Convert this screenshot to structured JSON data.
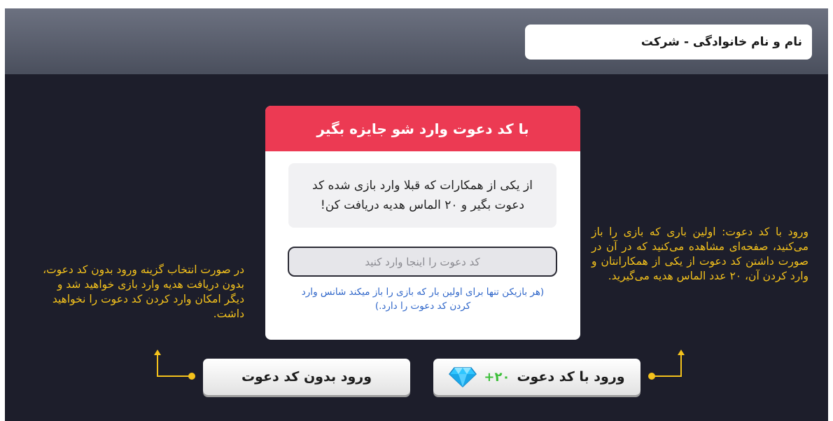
{
  "header": {
    "name_label": "نام و نام خانوادگی  -  شرکت"
  },
  "dialog": {
    "title": "با کد دعوت وارد شو جایزه بگیر",
    "message": "از یکی از همکارات که قبلا وارد بازی شده کد دعوت بگیر و ۲۰ الماس هدیه دریافت کن!",
    "input_placeholder": "کد دعوت را اینجا وارد کنید",
    "input_value": "",
    "note": "(هر بازیکن تنها برای اولین بار که بازی را باز میکند شانس وارد کردن کد دعوت را دارد.)"
  },
  "left_note": "در صورت انتخاب گزینه ورود بدون کد دعوت، بدون دریافت هدیه وارد بازی خواهید شد و دیگر امکان وارد کردن کد دعوت را نخواهید داشت.",
  "right_note": "ورود با کد دعوت: اولین باری که بازی را باز می‌کنید، صفحه‌ای مشاهده می‌کنید که در آن در صورت داشتن کد دعوت از یکی از همکارانتان و وارد کردن آن، ۲۰ عدد الماس هدیه می‌گیرید.",
  "buttons": {
    "no_code_label": "ورود بدون کد دعوت",
    "with_code_label": "ورود با کد دعوت",
    "bonus": "+۲۰"
  },
  "icons": {
    "gem": "diamond-icon"
  },
  "colors": {
    "background": "#1d1e2b",
    "header": "#5a5f6d",
    "accent_red": "#ec3a53",
    "annotation_yellow": "#f4c21c",
    "bonus_green": "#3dbf3a",
    "gem_blue": "#2fc6ff",
    "note_blue": "#2f66c9"
  }
}
